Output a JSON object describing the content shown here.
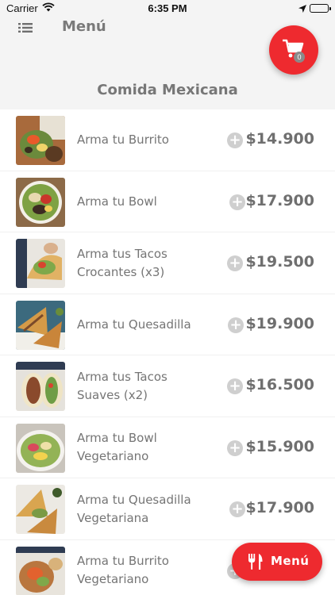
{
  "status_bar": {
    "carrier": "Carrier",
    "time": "6:35 PM"
  },
  "header": {
    "title": "Menú",
    "cart_count": "0"
  },
  "section_title": "Comida Mexicana",
  "items": [
    {
      "name": "Arma tu Burrito",
      "price": "$14.900"
    },
    {
      "name": "Arma tu Bowl",
      "price": "$17.900"
    },
    {
      "name": "Arma tus Tacos Crocantes (x3)",
      "price": "$19.500"
    },
    {
      "name": "Arma tu Quesadilla",
      "price": "$19.900"
    },
    {
      "name": "Arma tus Tacos Suaves (x2)",
      "price": "$16.500"
    },
    {
      "name": "Arma tu Bowl Vegetariano",
      "price": "$15.900"
    },
    {
      "name": "Arma tu Quesadilla Vegetariana",
      "price": "$17.900"
    },
    {
      "name": "Arma tu Burrito Vegetariano",
      "price": ""
    }
  ],
  "fab": {
    "label": "Menú"
  },
  "colors": {
    "accent": "#ee2a2f",
    "background": "#f4f4f4",
    "add_button": "#cfcfcf"
  }
}
